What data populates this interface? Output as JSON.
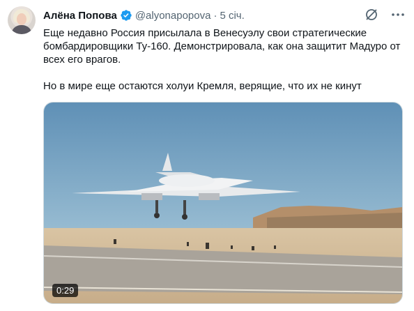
{
  "author": {
    "name": "Алёна Попова",
    "handle": "@alyonapopova",
    "separator": "·",
    "time": "5 січ."
  },
  "header_icons": [
    "grok-icon",
    "more-icon"
  ],
  "colors": {
    "verified": "#1d9bf0",
    "secondary_text": "#536471",
    "primary_text": "#0f1419"
  },
  "tweet": {
    "paragraph1": "Еще недавно Россия присылала в Венесуэлу свои стратегические бомбардировщики Ту-160. Демонстрировала, как она защитит Мадуро от всех его врагов.",
    "paragraph2": "Но в мире еще остаются холуи Кремля, верящие, что их не кинут"
  },
  "media": {
    "type": "video",
    "duration": "0:29"
  }
}
